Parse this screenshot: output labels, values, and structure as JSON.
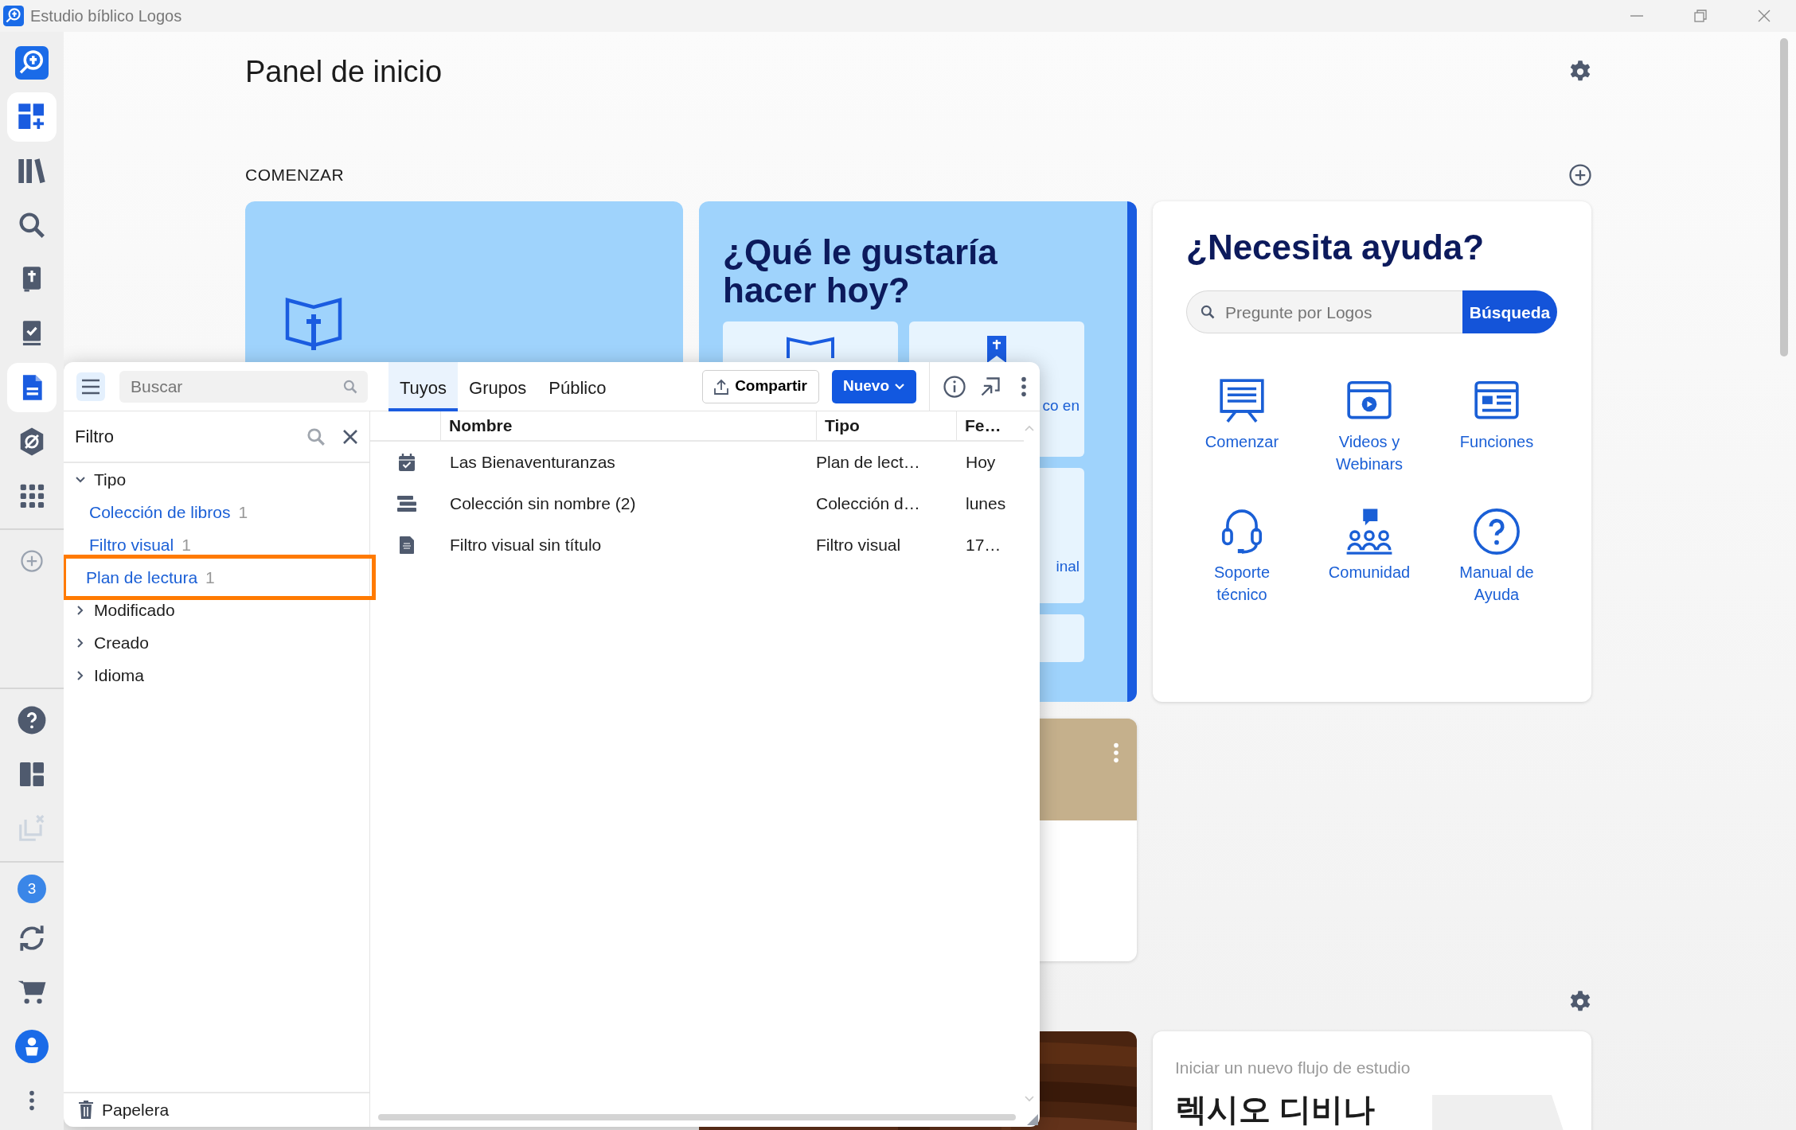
{
  "window": {
    "title": "Estudio bíblico Logos"
  },
  "rail": {
    "top": [
      {
        "selected": false
      },
      {
        "selected": true
      },
      {
        "selected": false
      },
      {
        "selected": false
      },
      {
        "selected": false
      },
      {
        "selected": false
      },
      {
        "selected": true
      },
      {
        "selected": false
      },
      {
        "selected": false
      }
    ],
    "tools": [
      {
        "disabled": false
      },
      {
        "disabled": false
      },
      {
        "disabled": true
      }
    ],
    "notifications": "3"
  },
  "dashboard": {
    "title": "Panel de inicio",
    "section": "COMENZAR",
    "question_card": {
      "title": "¿Qué le gustaría hacer hoy?",
      "tiles": [
        {
          "kind": "book"
        },
        {
          "kind": "bookmark",
          "text": "co en"
        },
        {
          "kind": "plain",
          "text": "inal"
        },
        {
          "kind": "plain"
        }
      ]
    },
    "help_card": {
      "title": "¿Necesita ayuda?",
      "search_placeholder": "Pregunte por Logos",
      "search_button": "Búsqueda",
      "links": [
        {
          "kind": "presentation",
          "label": "Comenzar"
        },
        {
          "kind": "video",
          "label": "Videos y Webinars"
        },
        {
          "kind": "webpage",
          "label": "Funciones"
        },
        {
          "kind": "headset",
          "label": "Soporte técnico"
        },
        {
          "kind": "community",
          "label": "Comunidad"
        },
        {
          "kind": "question",
          "label": "Manual de Ayuda"
        }
      ]
    },
    "flow_card": {
      "caption": "Iniciar un nuevo flujo de estudio",
      "title": "렉시오 디비나"
    }
  },
  "docs_panel": {
    "search_placeholder": "Buscar",
    "tabs": [
      {
        "label": "Tuyos",
        "selected": true
      },
      {
        "label": "Grupos",
        "selected": false
      },
      {
        "label": "Público",
        "selected": false
      }
    ],
    "share_button": "Compartir",
    "new_button": "Nuevo",
    "filter": {
      "title": "Filtro",
      "groups": [
        {
          "label": "Tipo",
          "expanded": true,
          "children": [
            {
              "label": "Colección de libros",
              "count": "1",
              "highlighted": false
            },
            {
              "label": "Filtro visual",
              "count": "1",
              "highlighted": false
            },
            {
              "label": "Plan de lectura",
              "count": "1",
              "highlighted": true
            }
          ]
        },
        {
          "label": "Modificado",
          "expanded": false
        },
        {
          "label": "Creado",
          "expanded": false
        },
        {
          "label": "Idioma",
          "expanded": false
        }
      ]
    },
    "trash": "Papelera",
    "columns": [
      "Nombre",
      "Tipo",
      "Fe…"
    ],
    "rows": [
      {
        "kind": "reading-plan",
        "name": "Las Bienaventuranzas",
        "type": "Plan de lect…",
        "date": "Hoy"
      },
      {
        "kind": "collection",
        "name": "Colección sin nombre (2)",
        "type": "Colección d…",
        "date": "lunes"
      },
      {
        "kind": "visual-filter",
        "name": "Filtro visual sin título",
        "type": "Filtro visual",
        "date": "17…"
      }
    ]
  }
}
